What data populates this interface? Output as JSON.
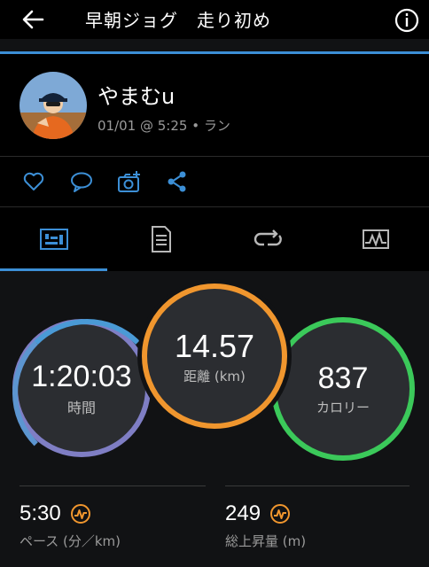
{
  "app_bar": {
    "title": "早朝ジョグ　走り初め"
  },
  "activity": {
    "user": "やまむu",
    "meta": "01/01 @ 5:25 • ラン"
  },
  "actions": [
    "like-icon",
    "comment-icon",
    "add-photo-icon",
    "share-icon"
  ],
  "tabs": [
    "stats-tab-icon",
    "details-tab-icon",
    "laps-tab-icon",
    "chart-tab-icon"
  ],
  "rings": {
    "time": {
      "value": "1:20:03",
      "label": "時間"
    },
    "distance": {
      "value": "14.57",
      "label": "距離 (km)"
    },
    "calories": {
      "value": "837",
      "label": "カロリー"
    }
  },
  "stats": {
    "pace": {
      "value": "5:30",
      "label": "ペース (分／km)"
    },
    "ascent": {
      "value": "249",
      "label": "総上昇量 (m)"
    }
  },
  "colors": {
    "accent": "#3c8fd6",
    "distance": "#f0962e",
    "calories": "#3bc95a",
    "time": "#7f7ec4"
  }
}
